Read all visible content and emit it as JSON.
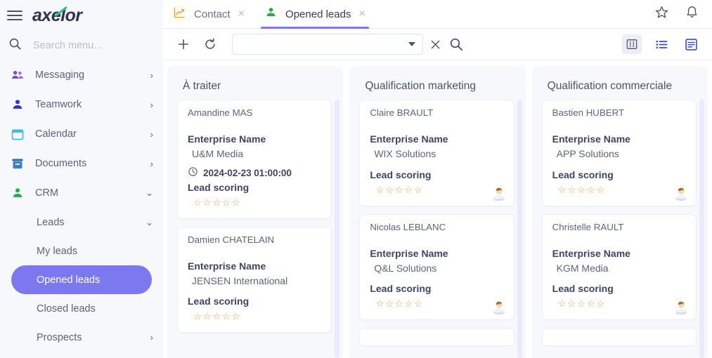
{
  "app": {
    "logo_text_a": "a",
    "logo_text_x": "x",
    "logo_text_b": "elor"
  },
  "sidebar": {
    "search_placeholder": "Search menu...",
    "items": [
      {
        "label": "Messaging",
        "icon": "people-icon",
        "chevron": "›"
      },
      {
        "label": "Teamwork",
        "icon": "person-icon",
        "chevron": "›"
      },
      {
        "label": "Calendar",
        "icon": "calendar-icon",
        "chevron": "›"
      },
      {
        "label": "Documents",
        "icon": "documents-icon",
        "chevron": "›"
      },
      {
        "label": "CRM",
        "icon": "person-green-icon",
        "chevron": "⌄"
      }
    ],
    "sub": {
      "label": "Leads",
      "chevron": "⌄"
    },
    "leaves": [
      {
        "label": "My leads",
        "active": false
      },
      {
        "label": "Opened leads",
        "active": true
      },
      {
        "label": "Closed leads",
        "active": false
      }
    ],
    "prospects": {
      "label": "Prospects",
      "chevron": "›"
    },
    "active_color": "#7c79f0"
  },
  "tabs": [
    {
      "label": "Contact",
      "icon": "chart-line-icon",
      "active": false,
      "close": "×"
    },
    {
      "label": "Opened leads",
      "icon": "person-green-icon",
      "active": true,
      "close": "×"
    }
  ],
  "topbar_icons": [
    {
      "name": "star-icon"
    },
    {
      "name": "bell-icon"
    }
  ],
  "toolbar": {
    "add_label": "+",
    "refresh_label": "refresh-icon",
    "search_value": "",
    "search_placeholder": "",
    "clear_label": "×",
    "search_icon": "search-icon",
    "views": [
      {
        "name": "kanban-view-button",
        "selected": true
      },
      {
        "name": "list-view-button",
        "selected": false
      },
      {
        "name": "form-view-button",
        "selected": false
      }
    ],
    "annotation_color": "#e8131a"
  },
  "kanban": {
    "field_label": "Enterprise Name",
    "score_label": "Lead scoring",
    "stars_empty": "☆☆☆☆☆",
    "columns": [
      {
        "title": "À traiter",
        "cards": [
          {
            "name": "Amandine MAS",
            "enterprise": "U&M Media",
            "date": "2024-02-23 01:00:00",
            "has_avatar": false
          },
          {
            "name": "Damien CHATELAIN",
            "enterprise": "JENSEN International",
            "date": "",
            "has_avatar": false
          }
        ]
      },
      {
        "title": "Qualification marketing",
        "cards": [
          {
            "name": "Claire BRAULT",
            "enterprise": "WIX Solutions",
            "date": "",
            "has_avatar": true
          },
          {
            "name": "Nicolas LEBLANC",
            "enterprise": "Q&L Solutions",
            "date": "",
            "has_avatar": true
          }
        ]
      },
      {
        "title": "Qualification commerciale",
        "cards": [
          {
            "name": "Bastien HUBERT",
            "enterprise": "APP Solutions",
            "date": "",
            "has_avatar": true
          },
          {
            "name": "Christelle RAULT",
            "enterprise": "KGM Media",
            "date": "",
            "has_avatar": true
          }
        ]
      }
    ]
  }
}
